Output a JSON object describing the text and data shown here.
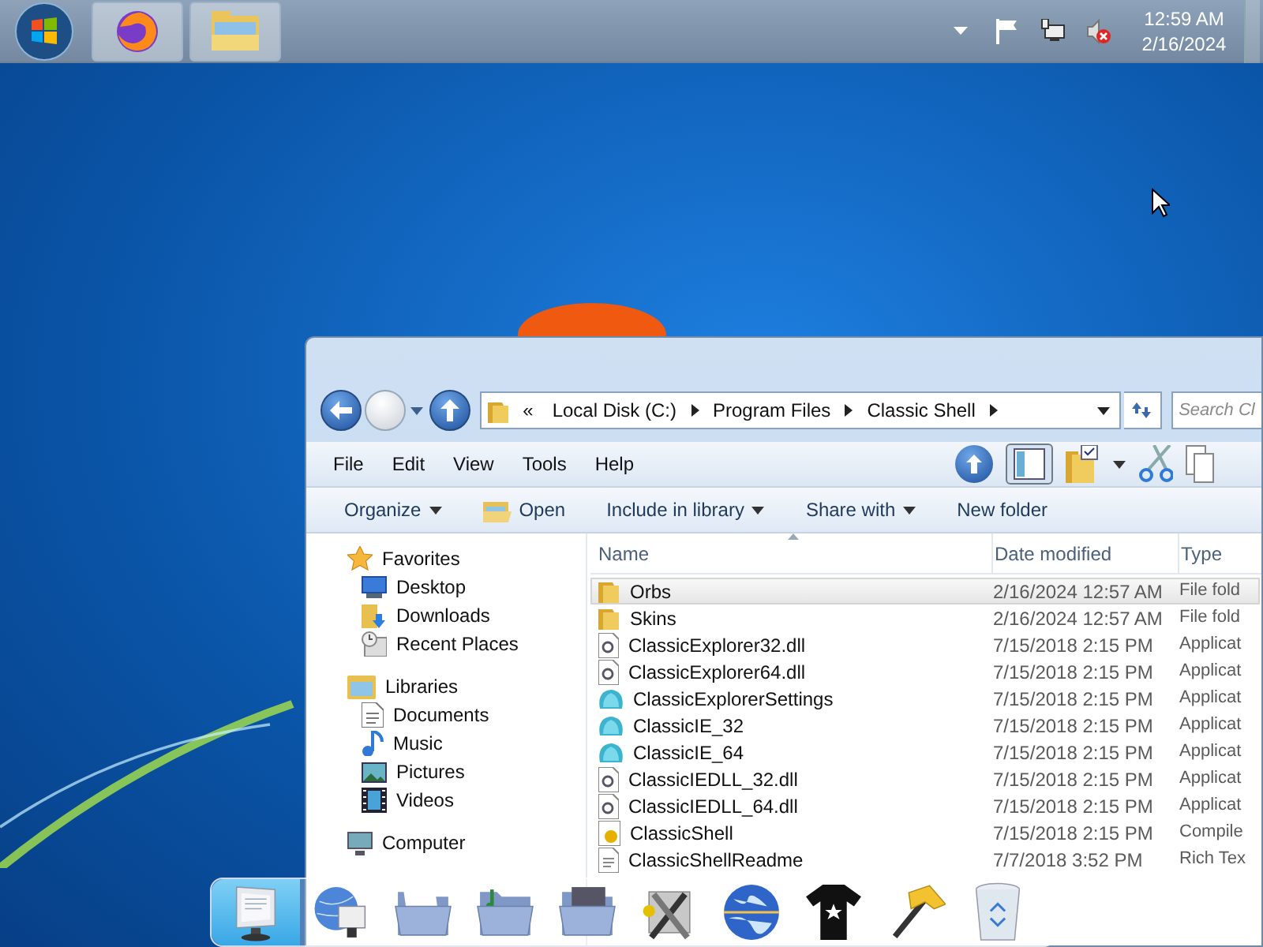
{
  "taskbar": {
    "buttons": [
      {
        "kind": "firefox",
        "selected": false
      },
      {
        "kind": "explorer",
        "selected": false
      }
    ],
    "tray": {
      "time": "12:59 AM",
      "date": "2/16/2024",
      "volume_muted": true
    }
  },
  "explorer": {
    "address": {
      "overflow": "«",
      "crumbs": [
        "Local Disk (C:)",
        "Program Files",
        "Classic Shell"
      ]
    },
    "search": {
      "placeholder": "Search Cl"
    },
    "menu": [
      "File",
      "Edit",
      "View",
      "Tools",
      "Help"
    ],
    "commands": [
      {
        "label": "Organize",
        "dropdown": true,
        "icon": false
      },
      {
        "label": "Open",
        "dropdown": false,
        "icon": true
      },
      {
        "label": "Include in library",
        "dropdown": true,
        "icon": false
      },
      {
        "label": "Share with",
        "dropdown": true,
        "icon": false
      },
      {
        "label": "New folder",
        "dropdown": false,
        "icon": false
      }
    ],
    "nav": [
      {
        "kind": "favorites",
        "label": "Favorites",
        "children": [
          {
            "kind": "desktop",
            "label": "Desktop"
          },
          {
            "kind": "downloads",
            "label": "Downloads"
          },
          {
            "kind": "recent",
            "label": "Recent Places"
          }
        ]
      },
      {
        "kind": "libraries",
        "label": "Libraries",
        "children": [
          {
            "kind": "documents",
            "label": "Documents"
          },
          {
            "kind": "music",
            "label": "Music"
          },
          {
            "kind": "pictures",
            "label": "Pictures"
          },
          {
            "kind": "videos",
            "label": "Videos"
          }
        ]
      },
      {
        "kind": "computer",
        "label": "Computer"
      }
    ],
    "columns": [
      "Name",
      "Date modified",
      "Type"
    ],
    "rows": [
      {
        "kind": "folder",
        "name": "Orbs",
        "date": "2/16/2024 12:57 AM",
        "type": "File fold",
        "selected": true
      },
      {
        "kind": "folder",
        "name": "Skins",
        "date": "2/16/2024 12:57 AM",
        "type": "File fold",
        "selected": false
      },
      {
        "kind": "dll",
        "name": "ClassicExplorer32.dll",
        "date": "7/15/2018 2:15 PM",
        "type": "Applicat",
        "selected": false
      },
      {
        "kind": "dll",
        "name": "ClassicExplorer64.dll",
        "date": "7/15/2018 2:15 PM",
        "type": "Applicat",
        "selected": false
      },
      {
        "kind": "app",
        "name": "ClassicExplorerSettings",
        "date": "7/15/2018 2:15 PM",
        "type": "Applicat",
        "selected": false
      },
      {
        "kind": "app",
        "name": "ClassicIE_32",
        "date": "7/15/2018 2:15 PM",
        "type": "Applicat",
        "selected": false
      },
      {
        "kind": "app",
        "name": "ClassicIE_64",
        "date": "7/15/2018 2:15 PM",
        "type": "Applicat",
        "selected": false
      },
      {
        "kind": "dll",
        "name": "ClassicIEDLL_32.dll",
        "date": "7/15/2018 2:15 PM",
        "type": "Applicat",
        "selected": false
      },
      {
        "kind": "dll",
        "name": "ClassicIEDLL_64.dll",
        "date": "7/15/2018 2:15 PM",
        "type": "Applicat",
        "selected": false
      },
      {
        "kind": "help",
        "name": "ClassicShell",
        "date": "7/15/2018 2:15 PM",
        "type": "Compile",
        "selected": false
      },
      {
        "kind": "text",
        "name": "ClassicShellReadme",
        "date": "7/7/2018 3:52 PM",
        "type": "Rich Tex",
        "selected": false
      }
    ]
  },
  "dock": [
    {
      "kind": "monitor",
      "selected": true
    },
    {
      "kind": "network",
      "selected": false
    },
    {
      "kind": "folder",
      "selected": false
    },
    {
      "kind": "music-folder",
      "selected": false
    },
    {
      "kind": "photo-folder",
      "selected": false
    },
    {
      "kind": "tools",
      "selected": false
    },
    {
      "kind": "globe",
      "selected": false
    },
    {
      "kind": "shirt",
      "selected": false
    },
    {
      "kind": "hammer",
      "selected": false
    },
    {
      "kind": "trash",
      "selected": false
    }
  ]
}
